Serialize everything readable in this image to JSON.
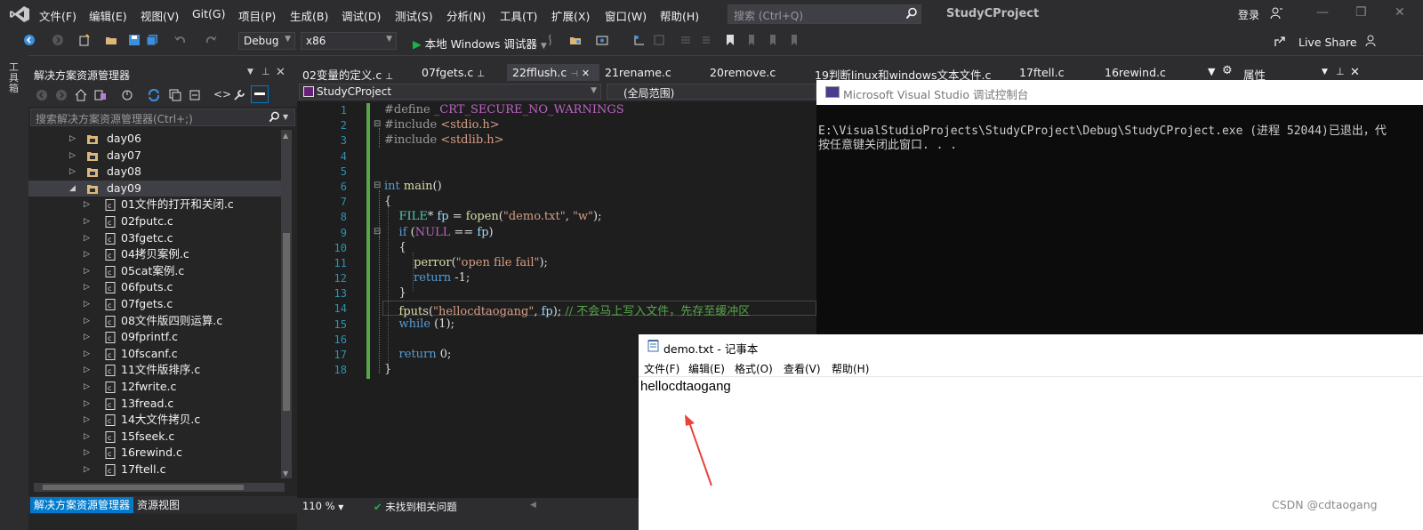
{
  "menu": [
    "文件(F)",
    "编辑(E)",
    "视图(V)",
    "Git(G)",
    "项目(P)",
    "生成(B)",
    "调试(D)",
    "测试(S)",
    "分析(N)",
    "工具(T)",
    "扩展(X)",
    "窗口(W)",
    "帮助(H)"
  ],
  "search_placeholder": "搜索 (Ctrl+Q)",
  "project_title": "StudyCProject",
  "login": "登录",
  "toolbar": {
    "config": "Debug",
    "platform": "x86",
    "run_label": "本地 Windows 调试器",
    "live_share": "Live Share"
  },
  "toolbox_tab": "工具箱",
  "solution_explorer": {
    "title": "解决方案资源管理器",
    "search_placeholder": "搜索解决方案资源管理器(Ctrl+;)",
    "folders": [
      "day06",
      "day07",
      "day08",
      "day09"
    ],
    "files": [
      "01文件的打开和关闭.c",
      "02fputc.c",
      "03fgetc.c",
      "04拷贝案例.c",
      "05cat案例.c",
      "06fputs.c",
      "07fgets.c",
      "08文件版四则运算.c",
      "09fprintf.c",
      "10fscanf.c",
      "11文件版排序.c",
      "12fwrite.c",
      "13fread.c",
      "14大文件拷贝.c",
      "15fseek.c",
      "16rewind.c",
      "17ftell.c"
    ],
    "bottom_tab_active": "解决方案资源管理器",
    "bottom_tab_other": "资源视图"
  },
  "doc_tabs": [
    "02变量的定义.c",
    "07fgets.c",
    "22fflush.c",
    "21rename.c",
    "20remove.c",
    "19判断linux和windows文本文件.c",
    "17ftell.c",
    "16rewind.c"
  ],
  "properties_tab": "属性",
  "editor": {
    "nav_project": "StudyCProject",
    "nav_scope": "(全局范围)",
    "line_numbers": [
      "1",
      "2",
      "3",
      "4",
      "5",
      "6",
      "7",
      "8",
      "9",
      "10",
      "11",
      "12",
      "13",
      "14",
      "15",
      "16",
      "17",
      "18"
    ],
    "zoom": "110 %",
    "issues": "未找到相关问题"
  },
  "console": {
    "title": "Microsoft Visual Studio 调试控制台",
    "line1": "E:\\VisualStudioProjects\\StudyCProject\\Debug\\StudyCProject.exe (进程 52044)已退出，代",
    "line2": "按任意键关闭此窗口. . ."
  },
  "notepad": {
    "title": "demo.txt - 记事本",
    "menu": [
      "文件(F)",
      "编辑(E)",
      "格式(O)",
      "查看(V)",
      "帮助(H)"
    ],
    "content": "hellocdtaogang"
  },
  "watermark": "CSDN @cdtaogang",
  "colors": {
    "accent": "#007acc",
    "bg": "#2d2d30",
    "editor_bg": "#1e1e1e",
    "keyword": "#569cd6",
    "string": "#d69d85",
    "comment": "#57a64a",
    "arrow": "#e8443a"
  }
}
